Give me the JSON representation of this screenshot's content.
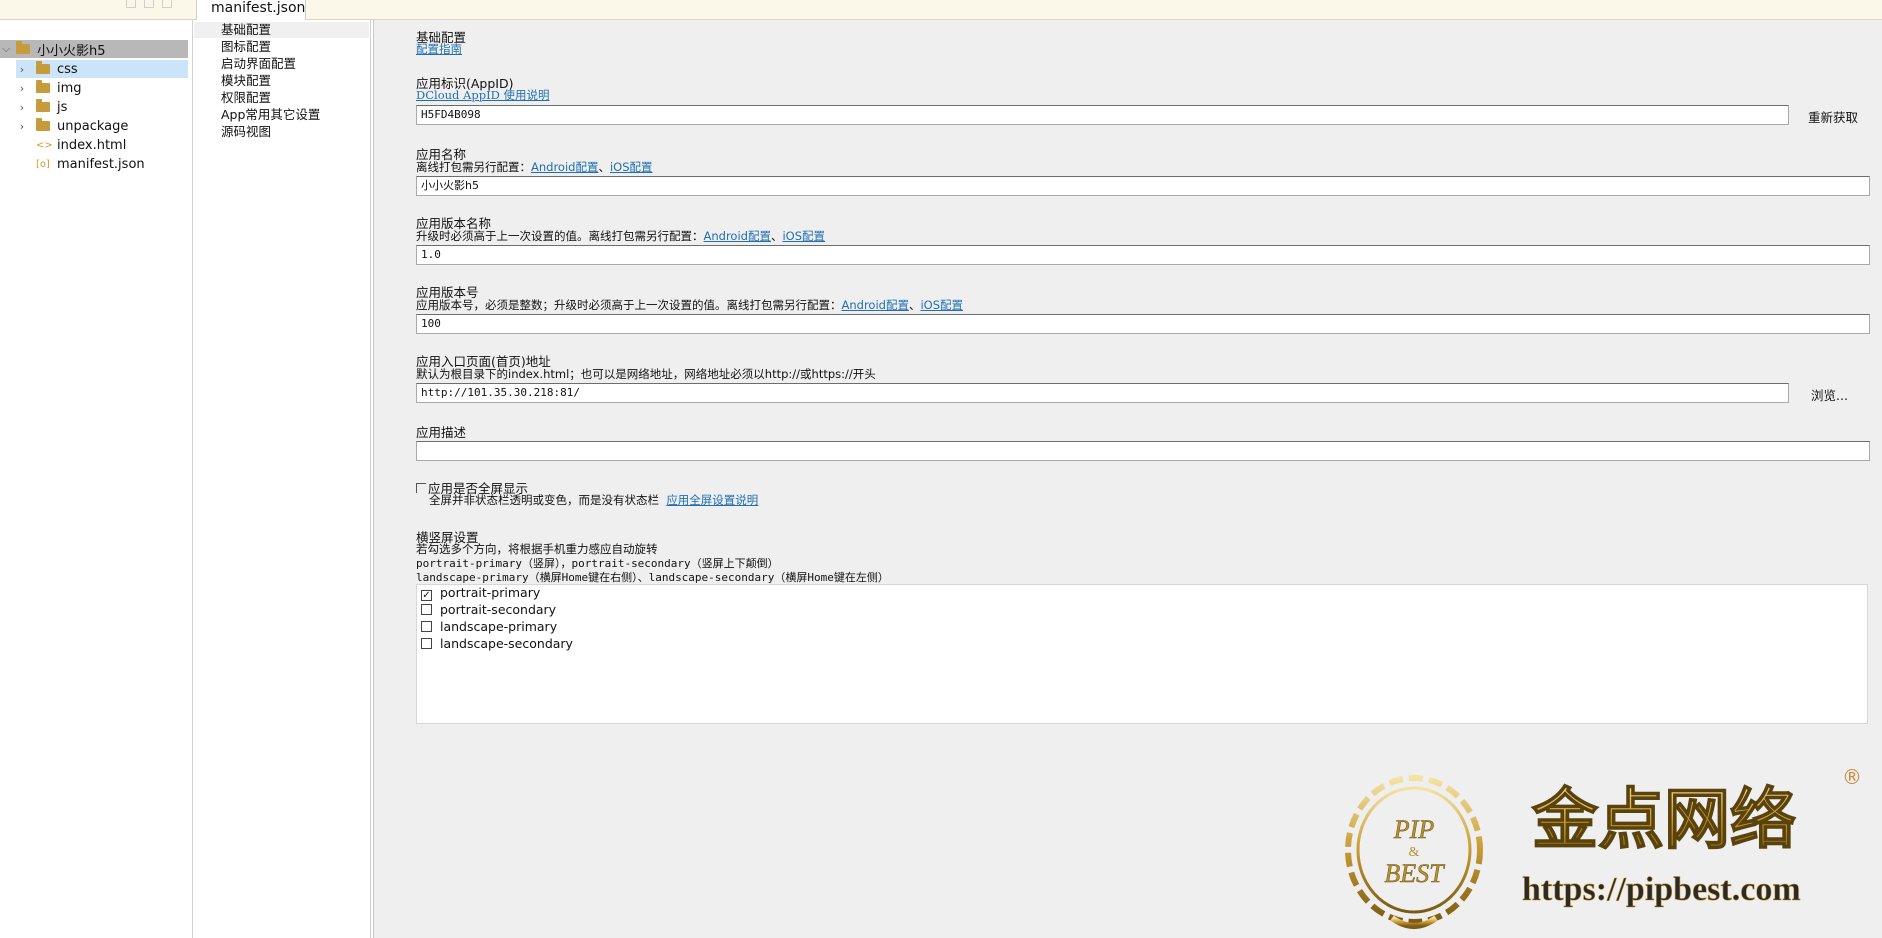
{
  "tab": {
    "title": "manifest.json"
  },
  "tree": {
    "project": "小小火影h5",
    "items": [
      {
        "name": "css",
        "kind": "folder"
      },
      {
        "name": "img",
        "kind": "folder"
      },
      {
        "name": "js",
        "kind": "folder"
      },
      {
        "name": "unpackage",
        "kind": "folder"
      },
      {
        "name": "index.html",
        "kind": "html"
      },
      {
        "name": "manifest.json",
        "kind": "json"
      }
    ]
  },
  "nav": {
    "items": [
      "基础配置",
      "图标配置",
      "启动界面配置",
      "模块配置",
      "权限配置",
      "App常用其它设置",
      "源码视图"
    ],
    "selected": 0
  },
  "form": {
    "section_title": "基础配置",
    "guide_link": "配置指南",
    "appid": {
      "label": "应用标识(AppID)",
      "link": "DCloud AppID 使用说明",
      "value": "H5FD4B098",
      "button": "重新获取"
    },
    "name": {
      "label": "应用名称",
      "hint": "离线打包需另行配置：",
      "android_link": "Android配置",
      "sep": "、",
      "ios_link": "iOS配置",
      "value": "小小火影h5"
    },
    "version_name": {
      "label": "应用版本名称",
      "hint": "升级时必须高于上一次设置的值。离线打包需另行配置：",
      "android_link": "Android配置",
      "sep": "、",
      "ios_link": "iOS配置",
      "value": "1.0"
    },
    "version_code": {
      "label": "应用版本号",
      "hint": "应用版本号，必须是整数；升级时必须高于上一次设置的值。离线打包需另行配置：",
      "android_link": "Android配置",
      "sep": "、",
      "ios_link": "iOS配置",
      "value": "100"
    },
    "entry": {
      "label": "应用入口页面(首页)地址",
      "hint": "默认为根目录下的index.html；也可以是网络地址，网络地址必须以http://或https://开头",
      "value": "http://101.35.30.218:81/",
      "button": "浏览..."
    },
    "description": {
      "label": "应用描述",
      "value": ""
    },
    "fullscreen": {
      "label": "应用是否全屏显示",
      "checked": false,
      "hint": "全屏并非状态栏透明或变色，而是没有状态栏",
      "link": "应用全屏设置说明"
    },
    "orientation": {
      "label": "横竖屏设置",
      "hint1": "若勾选多个方向，将根据手机重力感应自动旋转",
      "hint2": "portrait-primary（竖屏），portrait-secondary（竖屏上下颠倒）",
      "hint3": "landscape-primary（横屏Home键在右侧）、landscape-secondary（横屏Home键在左侧）",
      "options": [
        {
          "label": "portrait-primary",
          "checked": true
        },
        {
          "label": "portrait-secondary",
          "checked": false
        },
        {
          "label": "landscape-primary",
          "checked": false
        },
        {
          "label": "landscape-secondary",
          "checked": false
        }
      ]
    }
  },
  "watermark": {
    "emblem_top": "PIP",
    "emblem_mid": "&",
    "emblem_bottom": "BEST",
    "brand": "金点网络",
    "url": "https://pipbest.com",
    "registered": "®"
  },
  "colors": {
    "link": "#1f6fb2",
    "selection": "#cce4f7",
    "project_row": "#b8b8b8",
    "gold": "#b8902c"
  }
}
